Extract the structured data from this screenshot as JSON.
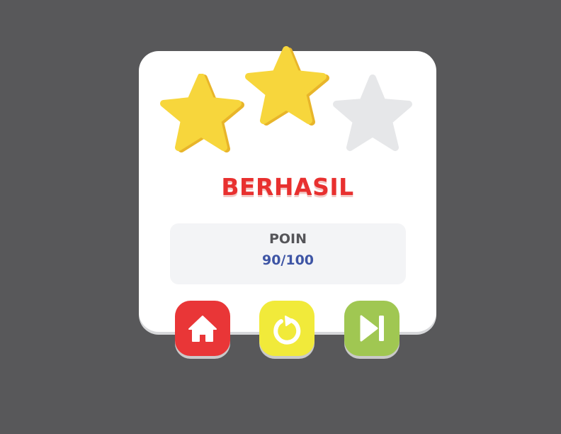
{
  "result": {
    "title": "BERHASIL",
    "stars_earned": 2,
    "stars_total": 3
  },
  "score": {
    "label": "POIN",
    "value": "90/100"
  },
  "buttons": {
    "home_icon": "home-icon",
    "retry_icon": "retry-icon",
    "next_icon": "next-icon"
  },
  "colors": {
    "background": "#58585a",
    "card": "#ffffff",
    "accent": "#e8302f",
    "star_filled": "#f7d63c",
    "star_empty": "#e6e7e9",
    "score_value": "#3e55a5",
    "home_button": "#e93637",
    "retry_button": "#f1ea3a",
    "next_button": "#a0c752"
  }
}
